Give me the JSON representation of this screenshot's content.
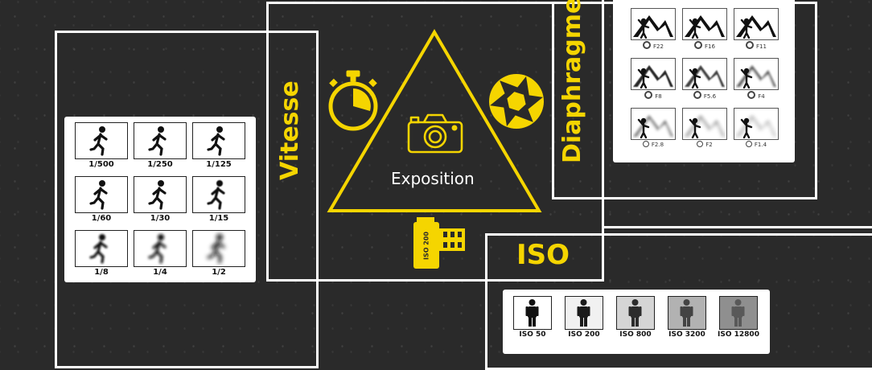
{
  "headings": {
    "speed": "Vitesse",
    "aperture": "Diaphragme",
    "iso": "ISO",
    "center": "Exposition"
  },
  "film_label": "ISO 200",
  "shutter_speeds": [
    "1/500",
    "1/250",
    "1/125",
    "1/60",
    "1/30",
    "1/15",
    "1/8",
    "1/4",
    "1/2"
  ],
  "shutter_blur": [
    0,
    0,
    0,
    0,
    0,
    0.6,
    1.2,
    1.8,
    2.6
  ],
  "apertures": [
    "F22",
    "F16",
    "F11",
    "F8",
    "F5.6",
    "F4",
    "F2.8",
    "F2",
    "F1.4"
  ],
  "aperture_blur": [
    0,
    0,
    0,
    0.4,
    0.8,
    1.2,
    1.6,
    2.0,
    2.4
  ],
  "iso_values": [
    "ISO 50",
    "ISO 200",
    "ISO 800",
    "ISO 3200",
    "ISO 12800"
  ],
  "iso_grain": [
    0,
    0.1,
    0.3,
    0.55,
    0.8
  ],
  "colors": {
    "accent": "#f5d500",
    "background": "#2a2a2a",
    "frame": "#ffffff"
  }
}
